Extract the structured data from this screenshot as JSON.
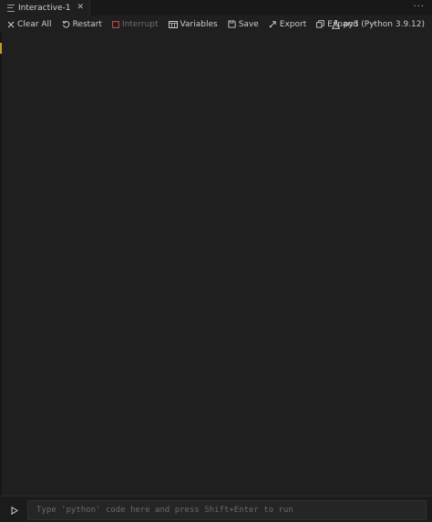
{
  "tab": {
    "label": "Interactive-1",
    "close_glyph": "✕",
    "icon": "file-lines-icon"
  },
  "tabbar": {
    "more_glyph": "···"
  },
  "toolbar": {
    "items": [
      {
        "label": "Clear All",
        "icon": "close-icon",
        "enabled": true
      },
      {
        "label": "Restart",
        "icon": "restart-icon",
        "enabled": true
      },
      {
        "label": "Interrupt",
        "icon": "stop-icon",
        "enabled": false
      },
      {
        "label": "Variables",
        "icon": "variables-icon",
        "enabled": true
      },
      {
        "label": "Save",
        "icon": "save-icon",
        "enabled": true
      },
      {
        "label": "Export",
        "icon": "export-icon",
        "enabled": true
      },
      {
        "label": "Expand",
        "icon": "expand-icon",
        "enabled": true
      }
    ],
    "more_glyph": "···",
    "kernel_label": "py3 (Python 3.9.12)",
    "kernel_icon": "flask-icon"
  },
  "input": {
    "placeholder": "Type 'python' code here and press Shift+Enter to run",
    "value": "",
    "run_icon": "play-icon"
  },
  "colors": {
    "background": "#1f1f1f",
    "accent": "#c89a2a",
    "interrupt": "#c94f4f"
  }
}
